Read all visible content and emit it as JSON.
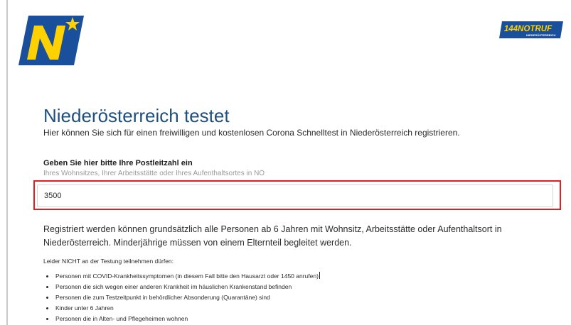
{
  "header": {
    "logo_left": {
      "text": "N",
      "icon": "noe-logo-icon",
      "colors": {
        "blue": "#1a4f9c",
        "yellow": "#ffd100"
      }
    },
    "logo_right": {
      "text": "144NOTRUF",
      "subtext": "NIEDERÖSTERREICH",
      "icon": "notruf-logo-icon",
      "colors": {
        "blue": "#1a4f9c",
        "yellow": "#ffd100"
      }
    }
  },
  "main": {
    "title": "Niederösterreich testet",
    "subtitle": "Hier können Sie sich für einen freiwilligen und kostenlosen Corona Schnelltest in Niederösterreich registrieren.",
    "postcode": {
      "label": "Geben Sie hier bitte Ihre Postleitzahl ein",
      "hint": "Ihres Wohnsitzes, Ihrer Arbeitsstätte oder Ihres Aufenthaltsortes in NÖ",
      "value": "3500"
    },
    "info": "Registriert werden können grundsätzlich alle Personen ab 6 Jahren mit Wohnsitz, Arbeitsstätte oder Aufenthaltsort in Niederösterreich. Minderjährige müssen von einem Elternteil begleitet werden.",
    "exclusions_title": "Leider NICHT an der Testung teilnehmen dürfen:",
    "exclusions": [
      "Personen mit COVID-Krankheitssymptomen (in diesem Fall bitte den Hausarzt oder 1450 anrufen)",
      "Personen die sich wegen einer anderen Krankheit im häuslichen Krankenstand befinden",
      "Personen die zum Testzeitpunkt in behördlicher Absonderung (Quarantäne) sind",
      "Kinder unter 6 Jahren",
      "Personen die in Alten- und Pflegeheimen wohnen"
    ]
  },
  "colors": {
    "title": "#1f4f7e",
    "highlight": "#e02020"
  }
}
